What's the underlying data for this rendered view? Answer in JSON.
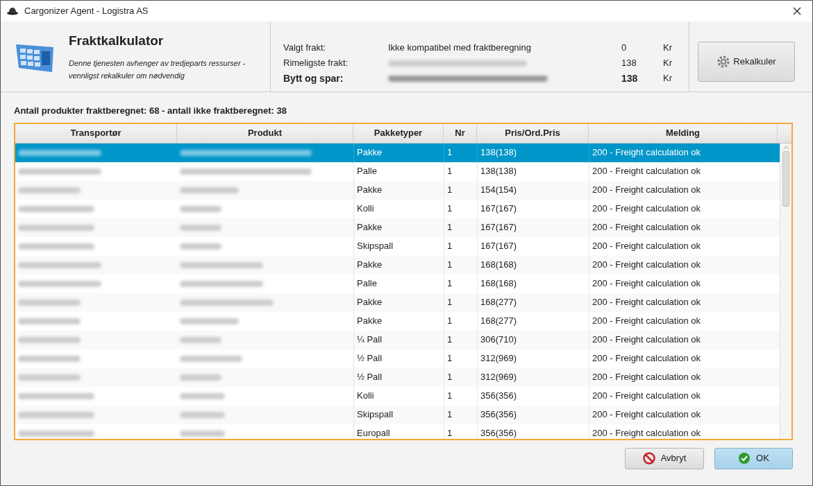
{
  "window": {
    "title": "Cargonizer Agent - Logistra AS"
  },
  "header": {
    "title": "Fraktkalkulator",
    "subtitle": "Denne tjenesten avhenger av tredjeparts ressurser - vennligst rekalkuler om nødvendig"
  },
  "summary": [
    {
      "label": "Valgt frakt:",
      "value": "Ikke kompatibel med fraktberegning",
      "value_blurred": false,
      "amount": "0",
      "currency": "Kr",
      "bold": false
    },
    {
      "label": "Rimeligste frakt:",
      "value_blurred": true,
      "amount": "138",
      "currency": "Kr",
      "bold": false
    },
    {
      "label": "Bytt og spar:",
      "value_blurred": true,
      "amount": "138",
      "currency": "Kr",
      "bold": true
    }
  ],
  "recalc_button": "Rekalkuler",
  "count_label": "Antall produkter fraktberegnet: 68 - antall ikke fraktberegnet: 38",
  "table": {
    "columns": [
      "Transportør",
      "Produkt",
      "Pakketyper",
      "Nr",
      "Pris/Ord.Pris",
      "Melding"
    ],
    "rows": [
      {
        "selected": true,
        "cells": [
          "Pakke",
          "1",
          "138(138)",
          "200 - Freight calculation ok"
        ]
      },
      {
        "selected": false,
        "cells": [
          "Palle",
          "1",
          "138(138)",
          "200 - Freight calculation ok"
        ]
      },
      {
        "selected": false,
        "cells": [
          "Pakke",
          "1",
          "154(154)",
          "200 - Freight calculation ok"
        ]
      },
      {
        "selected": false,
        "cells": [
          "Kolli",
          "1",
          "167(167)",
          "200 - Freight calculation ok"
        ]
      },
      {
        "selected": false,
        "cells": [
          "Pakke",
          "1",
          "167(167)",
          "200 - Freight calculation ok"
        ]
      },
      {
        "selected": false,
        "cells": [
          "Skipspall",
          "1",
          "167(167)",
          "200 - Freight calculation ok"
        ]
      },
      {
        "selected": false,
        "cells": [
          "Pakke",
          "1",
          "168(168)",
          "200 - Freight calculation ok"
        ]
      },
      {
        "selected": false,
        "cells": [
          "Palle",
          "1",
          "168(168)",
          "200 - Freight calculation ok"
        ]
      },
      {
        "selected": false,
        "cells": [
          "Pakke",
          "1",
          "168(277)",
          "200 - Freight calculation ok"
        ]
      },
      {
        "selected": false,
        "cells": [
          "Pakke",
          "1",
          "168(277)",
          "200 - Freight calculation ok"
        ]
      },
      {
        "selected": false,
        "cells": [
          "¼ Pall",
          "1",
          "306(710)",
          "200 - Freight calculation ok"
        ]
      },
      {
        "selected": false,
        "cells": [
          "½ Pall",
          "1",
          "312(969)",
          "200 - Freight calculation ok"
        ]
      },
      {
        "selected": false,
        "cells": [
          "½ Pall",
          "1",
          "312(969)",
          "200 - Freight calculation ok"
        ]
      },
      {
        "selected": false,
        "cells": [
          "Kolli",
          "1",
          "356(356)",
          "200 - Freight calculation ok"
        ]
      },
      {
        "selected": false,
        "cells": [
          "Skipspall",
          "1",
          "356(356)",
          "200 - Freight calculation ok"
        ]
      },
      {
        "selected": false,
        "cells": [
          "Europall",
          "1",
          "356(356)",
          "200 - Freight calculation ok"
        ]
      }
    ]
  },
  "buttons": [
    {
      "label": "Avbryt",
      "kind": "cancel"
    },
    {
      "label": "OK",
      "kind": "ok"
    }
  ]
}
